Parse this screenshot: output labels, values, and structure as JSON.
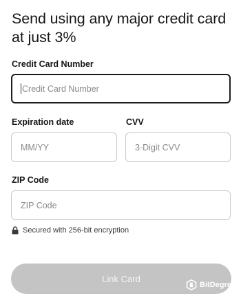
{
  "title": "Send using any major credit card at just 3%",
  "card_number": {
    "label": "Credit Card Number",
    "placeholder": "Credit Card Number"
  },
  "expiration": {
    "label": "Expiration date",
    "placeholder": "MM/YY"
  },
  "cvv": {
    "label": "CVV",
    "placeholder": "3-Digit CVV"
  },
  "zip": {
    "label": "ZIP Code",
    "placeholder": "ZIP Code"
  },
  "security_note": "Secured with 256-bit encryption",
  "submit_label": "Link Card",
  "watermark": "BitDegree",
  "icons": {
    "lock": "lock-icon",
    "watermark": "bitdegree-logo-icon"
  },
  "colors": {
    "focus_border": "#1c1c1c",
    "field_border": "#c9c9c9",
    "button_disabled": "#c4c4c4",
    "placeholder": "#8a8a8a"
  }
}
